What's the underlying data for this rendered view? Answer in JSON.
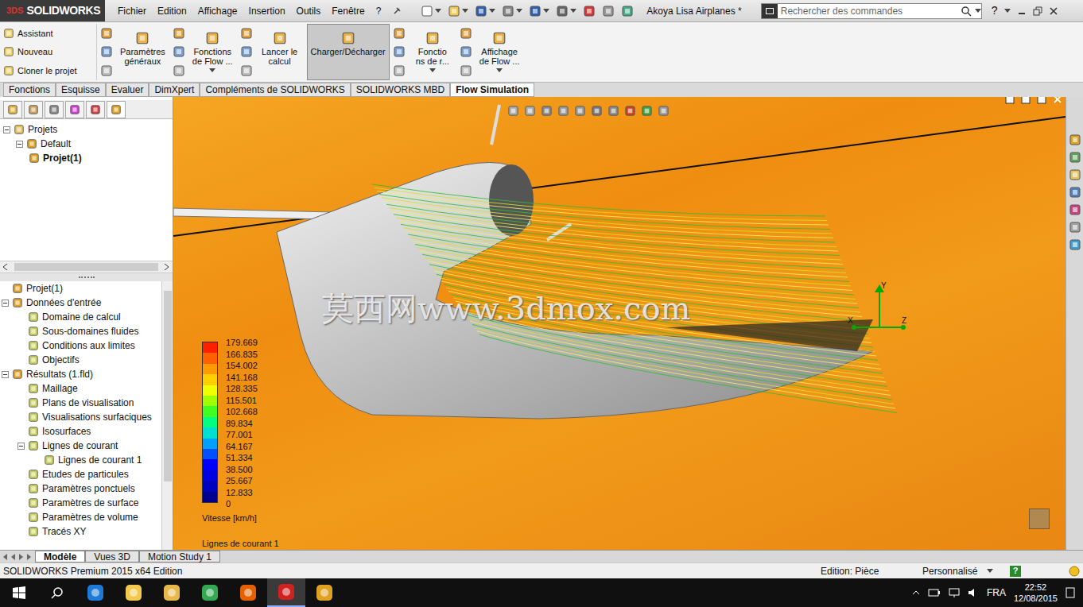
{
  "app": {
    "logo_mark": "3DS",
    "logo": "SOLIDWORKS"
  },
  "menu": [
    "Fichier",
    "Edition",
    "Affichage",
    "Insertion",
    "Outils",
    "Fenêtre",
    "?"
  ],
  "window": {
    "title": "Akoya Lisa Airplanes *"
  },
  "search": {
    "placeholder": "Rechercher des commandes"
  },
  "help": "?",
  "ribbon": [
    {
      "kind": "stack",
      "labels": [
        "Assistant",
        "Nouveau",
        "Cloner le projet"
      ]
    },
    {
      "kind": "big",
      "lines": [
        "Paramètres",
        "généraux"
      ],
      "selected": false,
      "dropdown": false
    },
    {
      "kind": "big",
      "lines": [
        "Fonctions",
        "de Flow ..."
      ],
      "selected": false,
      "dropdown": true
    },
    {
      "kind": "big",
      "lines": [
        "Lancer le",
        "calcul"
      ],
      "selected": false,
      "dropdown": false
    },
    {
      "kind": "big",
      "lines": [
        "Charger/Décharger"
      ],
      "selected": true,
      "dropdown": false
    },
    {
      "kind": "big",
      "lines": [
        "Fonctio",
        "ns de r..."
      ],
      "selected": false,
      "dropdown": true
    },
    {
      "kind": "big",
      "lines": [
        "Affichage",
        "de Flow ..."
      ],
      "selected": false,
      "dropdown": true
    }
  ],
  "tabs": [
    {
      "label": "Fonctions",
      "selected": false
    },
    {
      "label": "Esquisse",
      "selected": false
    },
    {
      "label": "Evaluer",
      "selected": false
    },
    {
      "label": "DimXpert",
      "selected": false
    },
    {
      "label": "Compléments de SOLIDWORKS",
      "selected": false
    },
    {
      "label": "SOLIDWORKS MBD",
      "selected": false
    },
    {
      "label": "Flow Simulation",
      "selected": true
    }
  ],
  "project_tree": [
    {
      "label": "Projets",
      "level": 0,
      "expanded": true,
      "bold": false
    },
    {
      "label": "Default",
      "level": 1,
      "expanded": true,
      "bold": false
    },
    {
      "label": "Projet(1)",
      "level": 2,
      "expanded": false,
      "bold": true
    }
  ],
  "analysis_tree": [
    {
      "label": "Projet(1)",
      "level": 0,
      "parent": false,
      "expanded": false
    },
    {
      "label": "Données d'entrée",
      "level": 0,
      "parent": true,
      "expanded": true
    },
    {
      "label": "Domaine de calcul",
      "level": 1,
      "parent": false,
      "expanded": false
    },
    {
      "label": "Sous-domaines fluides",
      "level": 1,
      "parent": false,
      "expanded": false
    },
    {
      "label": "Conditions aux limites",
      "level": 1,
      "parent": false,
      "expanded": false
    },
    {
      "label": "Objectifs",
      "level": 1,
      "parent": false,
      "expanded": false
    },
    {
      "label": "Résultats (1.fld)",
      "level": 0,
      "parent": true,
      "expanded": true
    },
    {
      "label": "Maillage",
      "level": 1,
      "parent": false,
      "expanded": false
    },
    {
      "label": "Plans de visualisation",
      "level": 1,
      "parent": false,
      "expanded": false
    },
    {
      "label": "Visualisations surfaciques",
      "level": 1,
      "parent": false,
      "expanded": false
    },
    {
      "label": "Isosurfaces",
      "level": 1,
      "parent": false,
      "expanded": false
    },
    {
      "label": "Lignes de courant",
      "level": 1,
      "parent": true,
      "expanded": true
    },
    {
      "label": "Lignes de courant 1",
      "level": 2,
      "parent": false,
      "expanded": false
    },
    {
      "label": "Etudes de particules",
      "level": 1,
      "parent": false,
      "expanded": false
    },
    {
      "label": "Paramètres ponctuels",
      "level": 1,
      "parent": false,
      "expanded": false
    },
    {
      "label": "Paramètres de surface",
      "level": 1,
      "parent": false,
      "expanded": false
    },
    {
      "label": "Paramètres de volume",
      "level": 1,
      "parent": false,
      "expanded": false
    },
    {
      "label": "Tracés XY",
      "level": 1,
      "parent": false,
      "expanded": false
    }
  ],
  "viewport": {
    "legend": {
      "ticks": [
        "179.669",
        "166.835",
        "154.002",
        "141.168",
        "128.335",
        "115.501",
        "102.668",
        "89.834",
        "77.001",
        "64.167",
        "51.334",
        "38.500",
        "25.667",
        "12.833",
        "0"
      ],
      "title": "Vitesse [km/h]"
    },
    "caption": "Lignes de courant 1",
    "watermark": "莫西网www.3dmox.com",
    "triad": {
      "y": "Y",
      "x": "X",
      "z": "Z"
    }
  },
  "bottom_tabs": [
    {
      "label": "Modèle",
      "selected": true
    },
    {
      "label": "Vues 3D",
      "selected": false
    },
    {
      "label": "Motion Study 1",
      "selected": false
    }
  ],
  "status_bar": {
    "edition": "SOLIDWORKS Premium 2015 x64 Edition",
    "mode": "Edition: Pièce",
    "units": "Personnalisé",
    "help": "?"
  },
  "taskbar": {
    "apps": [
      {
        "name": "edge",
        "active": false
      },
      {
        "name": "explorer",
        "active": false
      },
      {
        "name": "photos",
        "active": false
      },
      {
        "name": "chrome",
        "active": false
      },
      {
        "name": "firefox",
        "active": false
      },
      {
        "name": "solidworks",
        "active": true
      },
      {
        "name": "flow",
        "active": false
      }
    ],
    "language": "FRA",
    "time": "22:52",
    "date": "12/08/2015"
  }
}
